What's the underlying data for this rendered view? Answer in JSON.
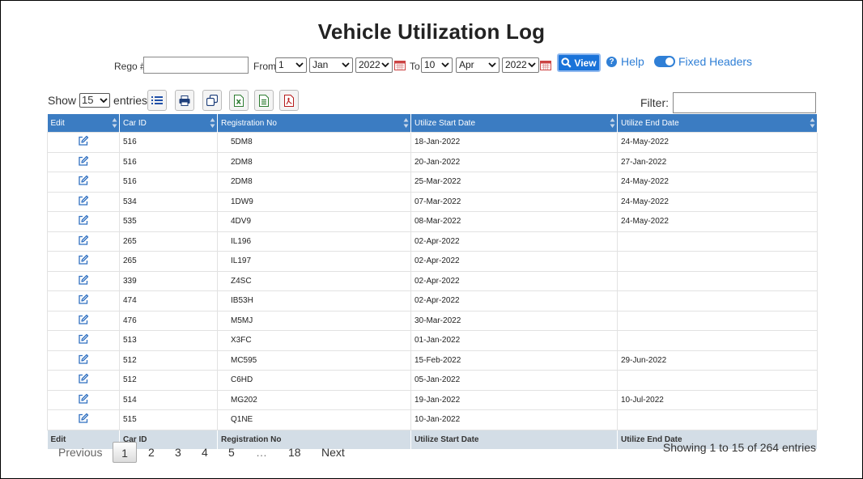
{
  "title": "Vehicle Utilization Log",
  "filters": {
    "rego_label": "Rego #",
    "rego_value": "",
    "from_label": "From",
    "from_day": "1",
    "from_month": "Jan",
    "from_year": "2022",
    "to_label": "To",
    "to_day": "10",
    "to_month": "Apr",
    "to_year": "2022",
    "view_label": "View",
    "help_label": "Help",
    "fixed_headers_label": "Fixed Headers"
  },
  "length_menu": {
    "show_label": "Show",
    "value": "15",
    "entries_label": "entries"
  },
  "toolbar": [
    "list-icon",
    "print-icon",
    "copy-icon",
    "excel-icon",
    "csv-icon",
    "pdf-icon"
  ],
  "filter_label": "Filter:",
  "table": {
    "columns": [
      "Edit",
      "Car ID",
      "Registration No",
      "Utilize Start Date",
      "Utilize End Date"
    ],
    "rows": [
      {
        "car_id": "516",
        "reg": "5DM8",
        "start": "18-Jan-2022",
        "end": "24-May-2022"
      },
      {
        "car_id": "516",
        "reg": "2DM8",
        "start": "20-Jan-2022",
        "end": "27-Jan-2022"
      },
      {
        "car_id": "516",
        "reg": "2DM8",
        "start": "25-Mar-2022",
        "end": "24-May-2022"
      },
      {
        "car_id": "534",
        "reg": "1DW9",
        "start": "07-Mar-2022",
        "end": "24-May-2022"
      },
      {
        "car_id": "535",
        "reg": "4DV9",
        "start": "08-Mar-2022",
        "end": "24-May-2022"
      },
      {
        "car_id": "265",
        "reg": "IL196",
        "start": "02-Apr-2022",
        "end": ""
      },
      {
        "car_id": "265",
        "reg": "IL197",
        "start": "02-Apr-2022",
        "end": ""
      },
      {
        "car_id": "339",
        "reg": "Z4SC",
        "start": "02-Apr-2022",
        "end": ""
      },
      {
        "car_id": "474",
        "reg": "IB53H",
        "start": "02-Apr-2022",
        "end": ""
      },
      {
        "car_id": "476",
        "reg": "M5MJ",
        "start": "30-Mar-2022",
        "end": ""
      },
      {
        "car_id": "513",
        "reg": "X3FC",
        "start": "01-Jan-2022",
        "end": ""
      },
      {
        "car_id": "512",
        "reg": "MC595",
        "start": "15-Feb-2022",
        "end": "29-Jun-2022"
      },
      {
        "car_id": "512",
        "reg": "C6HD",
        "start": "05-Jan-2022",
        "end": ""
      },
      {
        "car_id": "514",
        "reg": "MG202",
        "start": "19-Jan-2022",
        "end": "10-Jul-2022"
      },
      {
        "car_id": "515",
        "reg": "Q1NE",
        "start": "10-Jan-2022",
        "end": ""
      }
    ]
  },
  "pagination": {
    "previous": "Previous",
    "pages": [
      "1",
      "2",
      "3",
      "4",
      "5",
      "…",
      "18"
    ],
    "current": "1",
    "next": "Next"
  },
  "info": "Showing 1 to 15 of 264 entries",
  "colors": {
    "header_bg": "#3b7cc2",
    "footer_bg": "#d3dde6",
    "accent": "#1a73d9",
    "link": "#2f7fd6"
  }
}
